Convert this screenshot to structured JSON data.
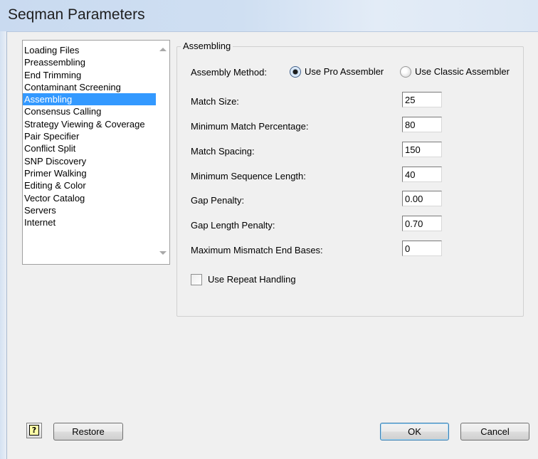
{
  "window": {
    "title": "Seqman Parameters"
  },
  "categories": [
    "Loading Files",
    "Preassembling",
    "End Trimming",
    "Contaminant Screening",
    "Assembling",
    "Consensus Calling",
    "Strategy Viewing & Coverage",
    "Pair Specifier",
    "Conflict Split",
    "SNP Discovery",
    "Primer Walking",
    "Editing & Color",
    "Vector Catalog",
    "Servers",
    "Internet"
  ],
  "selected_category": "Assembling",
  "panel": {
    "group_title": "Assembling",
    "assembly_method_label": "Assembly Method:",
    "option_pro": "Use Pro Assembler",
    "option_classic": "Use Classic Assembler",
    "selected_method": "Use Pro Assembler",
    "fields": {
      "match_size": {
        "label": "Match Size:",
        "value": "25"
      },
      "min_match_pct": {
        "label": "Minimum Match Percentage:",
        "value": "80"
      },
      "match_spacing": {
        "label": "Match Spacing:",
        "value": "150"
      },
      "min_seq_length": {
        "label": "Minimum Sequence Length:",
        "value": "40"
      },
      "gap_penalty": {
        "label": "Gap Penalty:",
        "value": "0.00"
      },
      "gap_length_penalty": {
        "label": "Gap Length Penalty:",
        "value": "0.70"
      },
      "max_mismatch_end": {
        "label": "Maximum Mismatch End Bases:",
        "value": "0"
      }
    },
    "repeat_handling_label": "Use Repeat Handling",
    "repeat_handling_checked": false
  },
  "buttons": {
    "help_glyph": "?",
    "restore": "Restore",
    "ok": "OK",
    "cancel": "Cancel"
  },
  "colors": {
    "selection": "#3399ff",
    "title_bar": "#cfdff2"
  }
}
